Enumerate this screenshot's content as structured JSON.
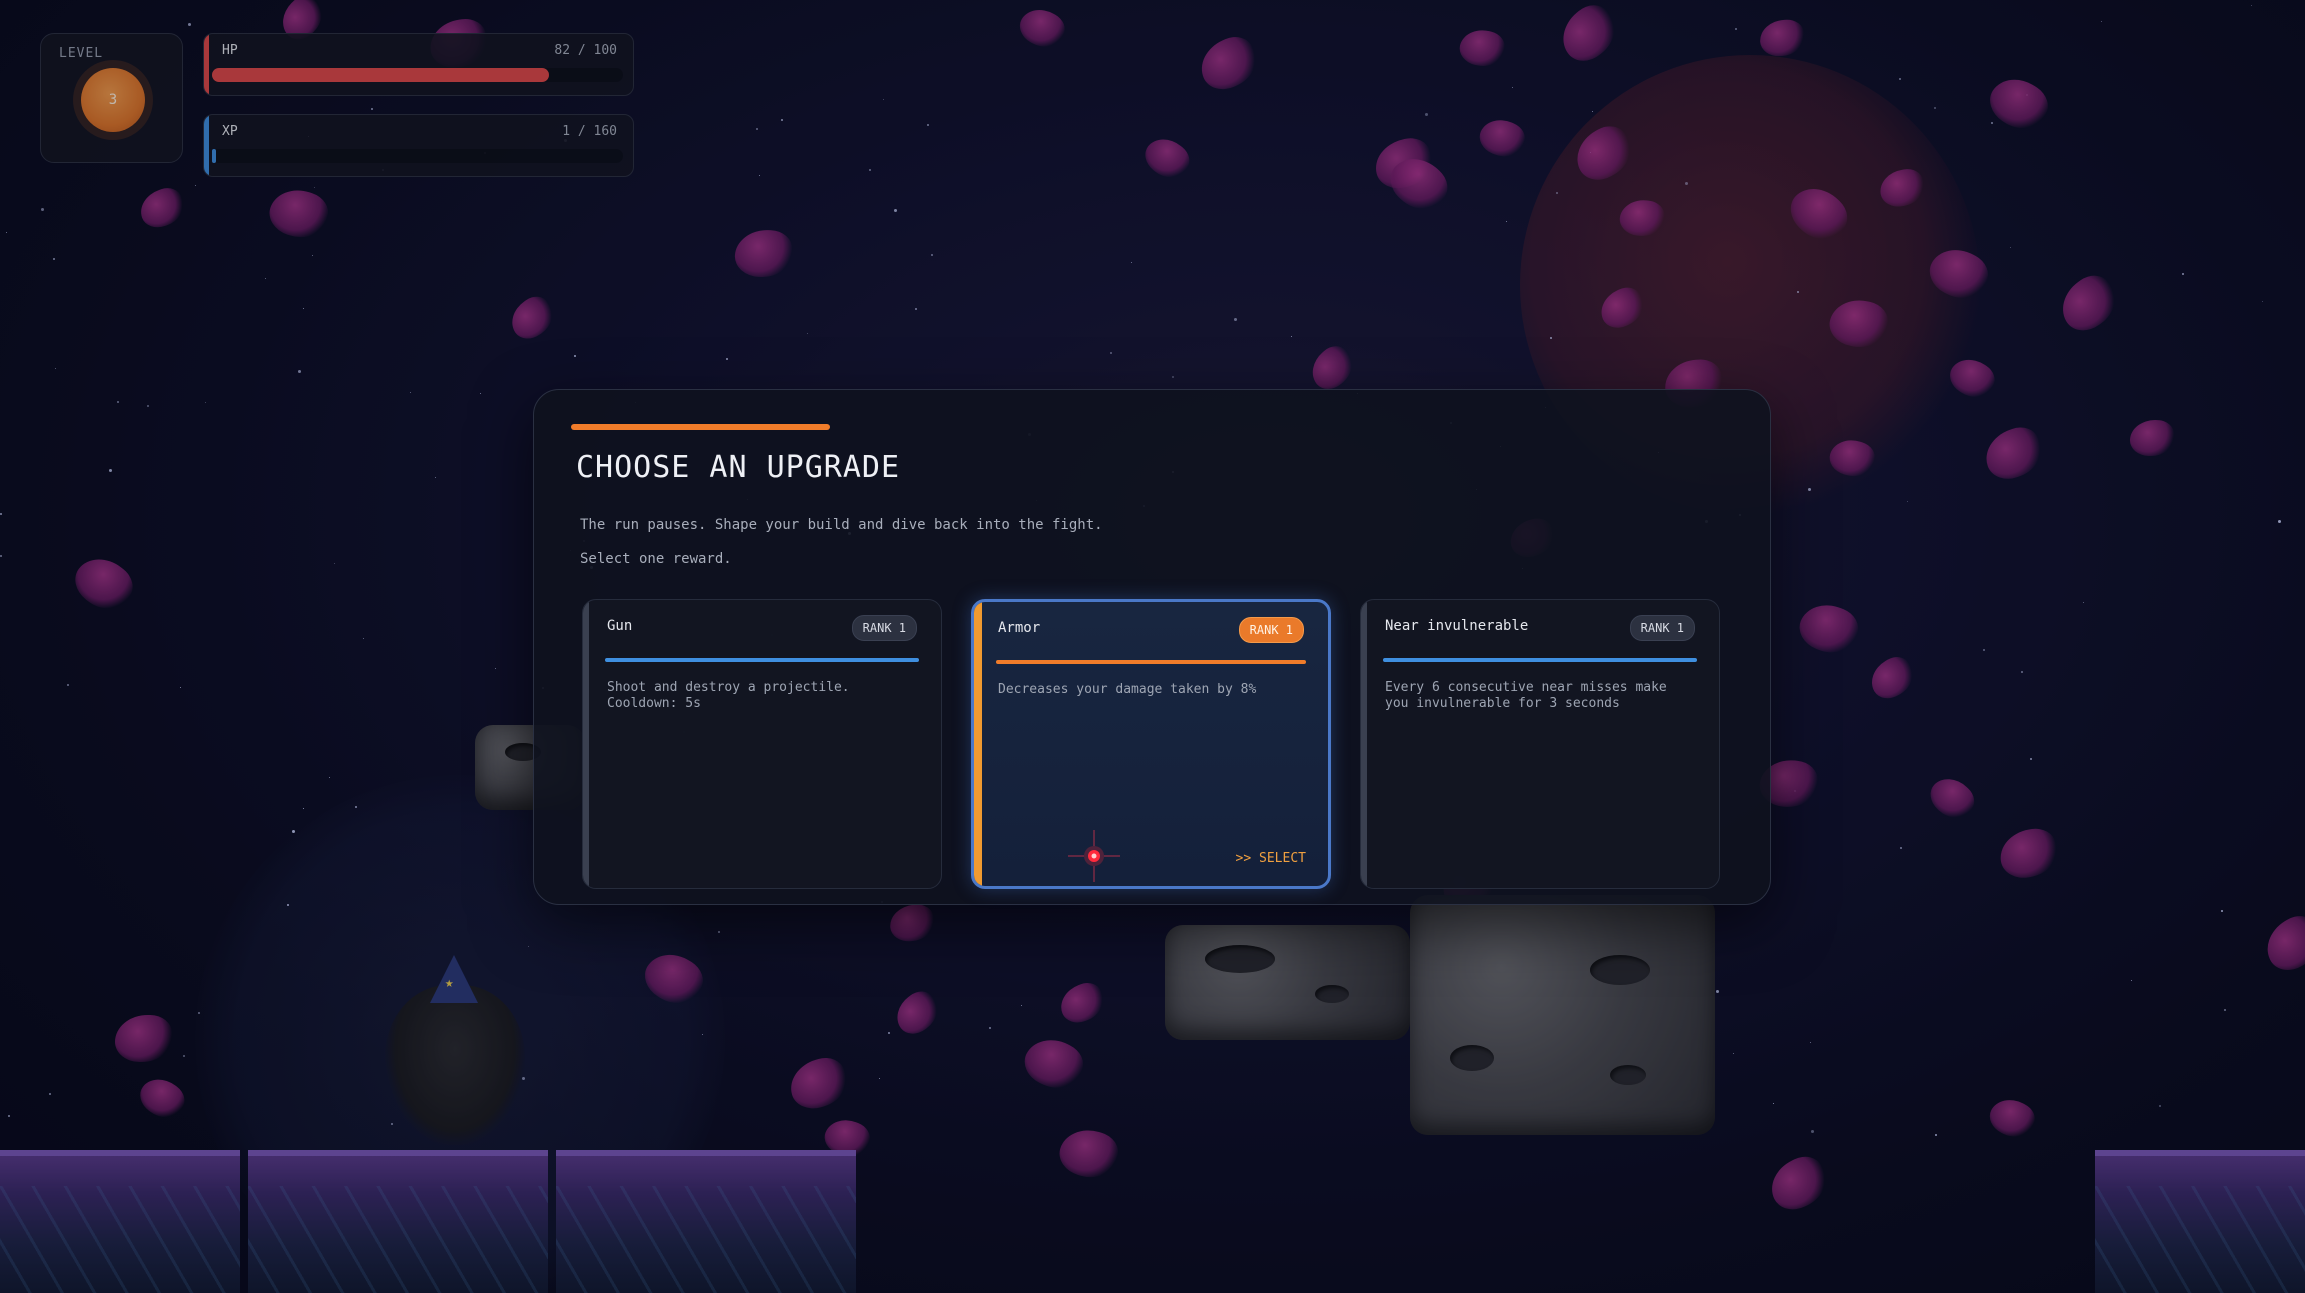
{
  "hud": {
    "level": {
      "label": "LEVEL",
      "value": "3"
    },
    "hp": {
      "label": "HP",
      "text": "82 / 100",
      "current": 82,
      "max": 100,
      "color": "#e04848"
    },
    "xp": {
      "label": "XP",
      "text": "1 / 160",
      "current": 1,
      "max": 160,
      "color": "#3f8fe0"
    }
  },
  "dialog": {
    "title": "CHOOSE AN UPGRADE",
    "subtitle": "The run pauses. Shape your build and dive back into the fight.",
    "hint": "Select one reward.",
    "accent_color": "#f07c2a",
    "cards": [
      {
        "title": "Gun",
        "rank": "RANK 1",
        "description": "Shoot and destroy a projectile.\nCooldown: 5s",
        "selected": false
      },
      {
        "title": "Armor",
        "rank": "RANK 1",
        "description": "Decreases your damage taken by 8%",
        "selected": true,
        "select_label": ">> SELECT"
      },
      {
        "title": "Near invulnerable",
        "rank": "RANK 1",
        "description": "Every 6 consecutive near misses make\nyou invulnerable for 3 seconds",
        "selected": false
      }
    ]
  }
}
